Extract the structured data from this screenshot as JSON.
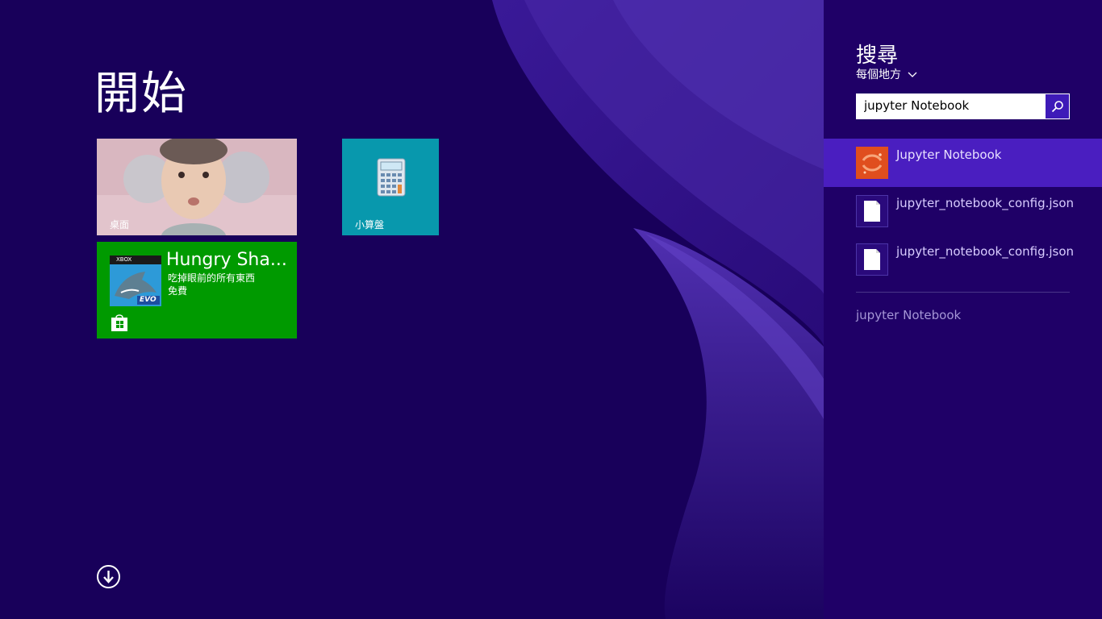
{
  "start": {
    "title": "開始",
    "tiles": {
      "desktop": {
        "label": "桌面"
      },
      "calculator": {
        "label": "小算盤"
      },
      "store_app": {
        "title": "Hungry Sha...",
        "description": "吃掉眼前的所有東西",
        "price": "免費",
        "badge": "XBOX",
        "art_text": "EVO"
      }
    },
    "all_apps_icon": "down-arrow-circle-icon"
  },
  "search": {
    "heading": "搜尋",
    "scope": "每個地方",
    "query": "jupyter Notebook",
    "results": [
      {
        "label": "Jupyter Notebook",
        "icon": "jupyter-app-icon",
        "selected": true
      },
      {
        "label": "jupyter_notebook_config.json",
        "icon": "file-icon"
      },
      {
        "label": "jupyter_notebook_config.json",
        "icon": "file-icon"
      }
    ],
    "web_suggestion": "jupyter Notebook"
  },
  "colors": {
    "background": "#18005a",
    "pane": "#1f0067",
    "selected_result": "#4a1ec0",
    "calc_tile": "#0898ad",
    "store_tile": "#009a00",
    "jupyter_orange": "#e85e2a"
  }
}
